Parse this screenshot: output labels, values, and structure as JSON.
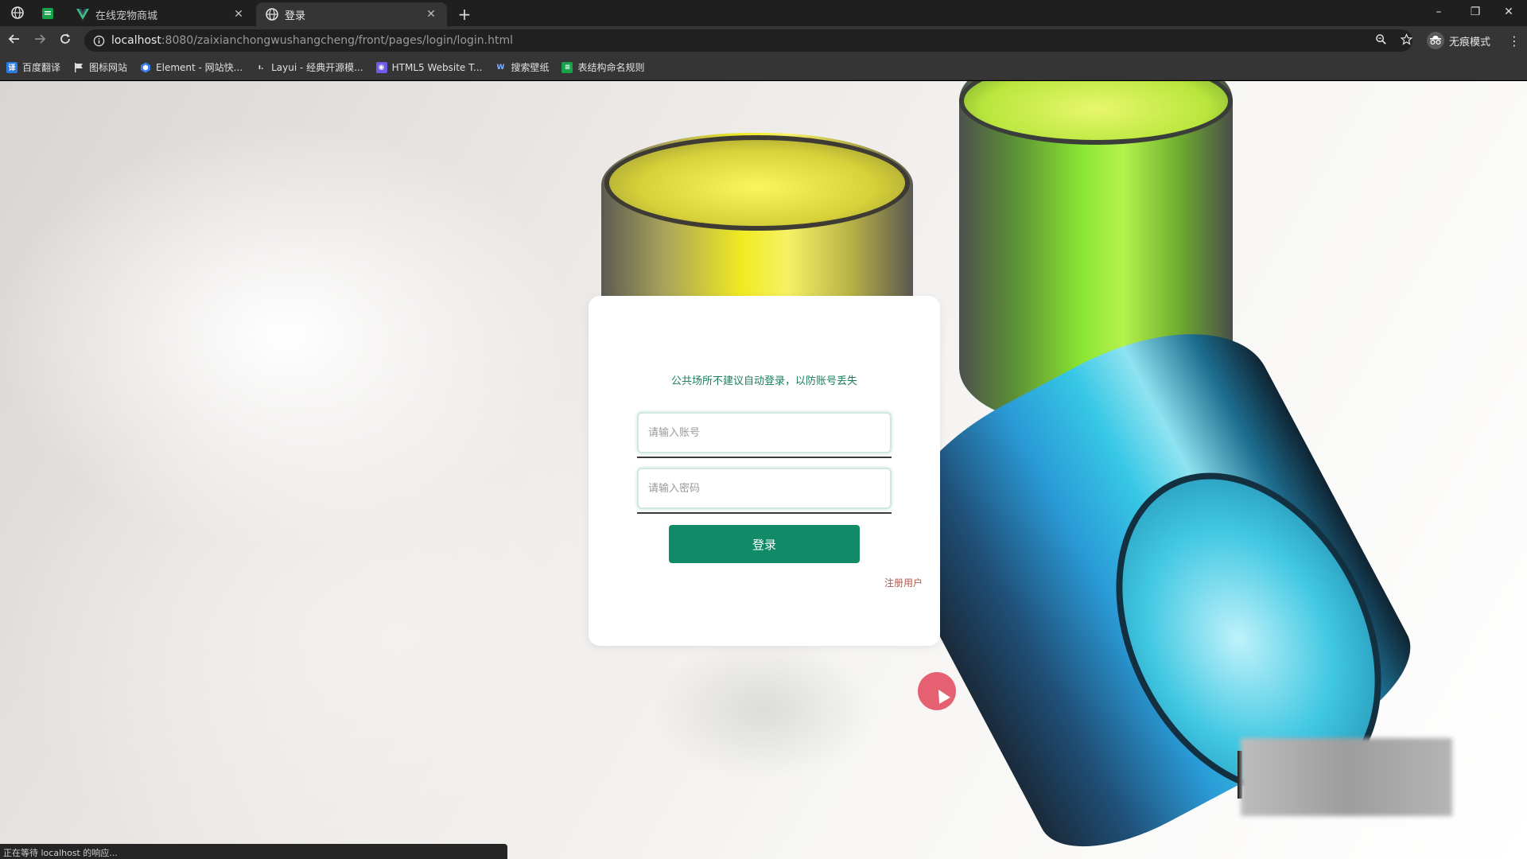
{
  "browser": {
    "tabs": [
      {
        "title": "在线宠物商城",
        "icon": "vue-icon",
        "active": false
      },
      {
        "title": "登录",
        "icon": "globe-icon",
        "active": true
      }
    ],
    "url_host": "localhost",
    "url_path": ":8080/zaixianchongwushangcheng/front/pages/login/login.html",
    "incognito_label": "无痕模式",
    "bookmarks": [
      {
        "label": "百度翻译",
        "icon": "baidu-translate-icon",
        "color": "#2b7be5"
      },
      {
        "label": "图标网站",
        "icon": "flag-icon",
        "color": "#444444"
      },
      {
        "label": "Element - 网站快...",
        "icon": "element-icon",
        "color": "#3b82f6"
      },
      {
        "label": "Layui - 经典开源模...",
        "icon": "layui-icon",
        "color": "#555555"
      },
      {
        "label": "HTML5 Website T...",
        "icon": "html5-template-icon",
        "color": "#6c5ce7"
      },
      {
        "label": "搜索壁纸",
        "icon": "wallpaper-search-icon",
        "color": "#3a7bd5"
      },
      {
        "label": "表结构命名规则",
        "icon": "sheet-icon",
        "color": "#16a34a"
      }
    ],
    "status": "正在等待 localhost 的响应..."
  },
  "login": {
    "notice": "公共场所不建议自动登录，以防账号丢失",
    "username_placeholder": "请输入账号",
    "password_placeholder": "请输入密码",
    "login_button": "登录",
    "register_link": "注册用户"
  },
  "colors": {
    "primary": "#118a67",
    "notice_text": "#1a7d5f",
    "register_link": "#b05a4f"
  }
}
